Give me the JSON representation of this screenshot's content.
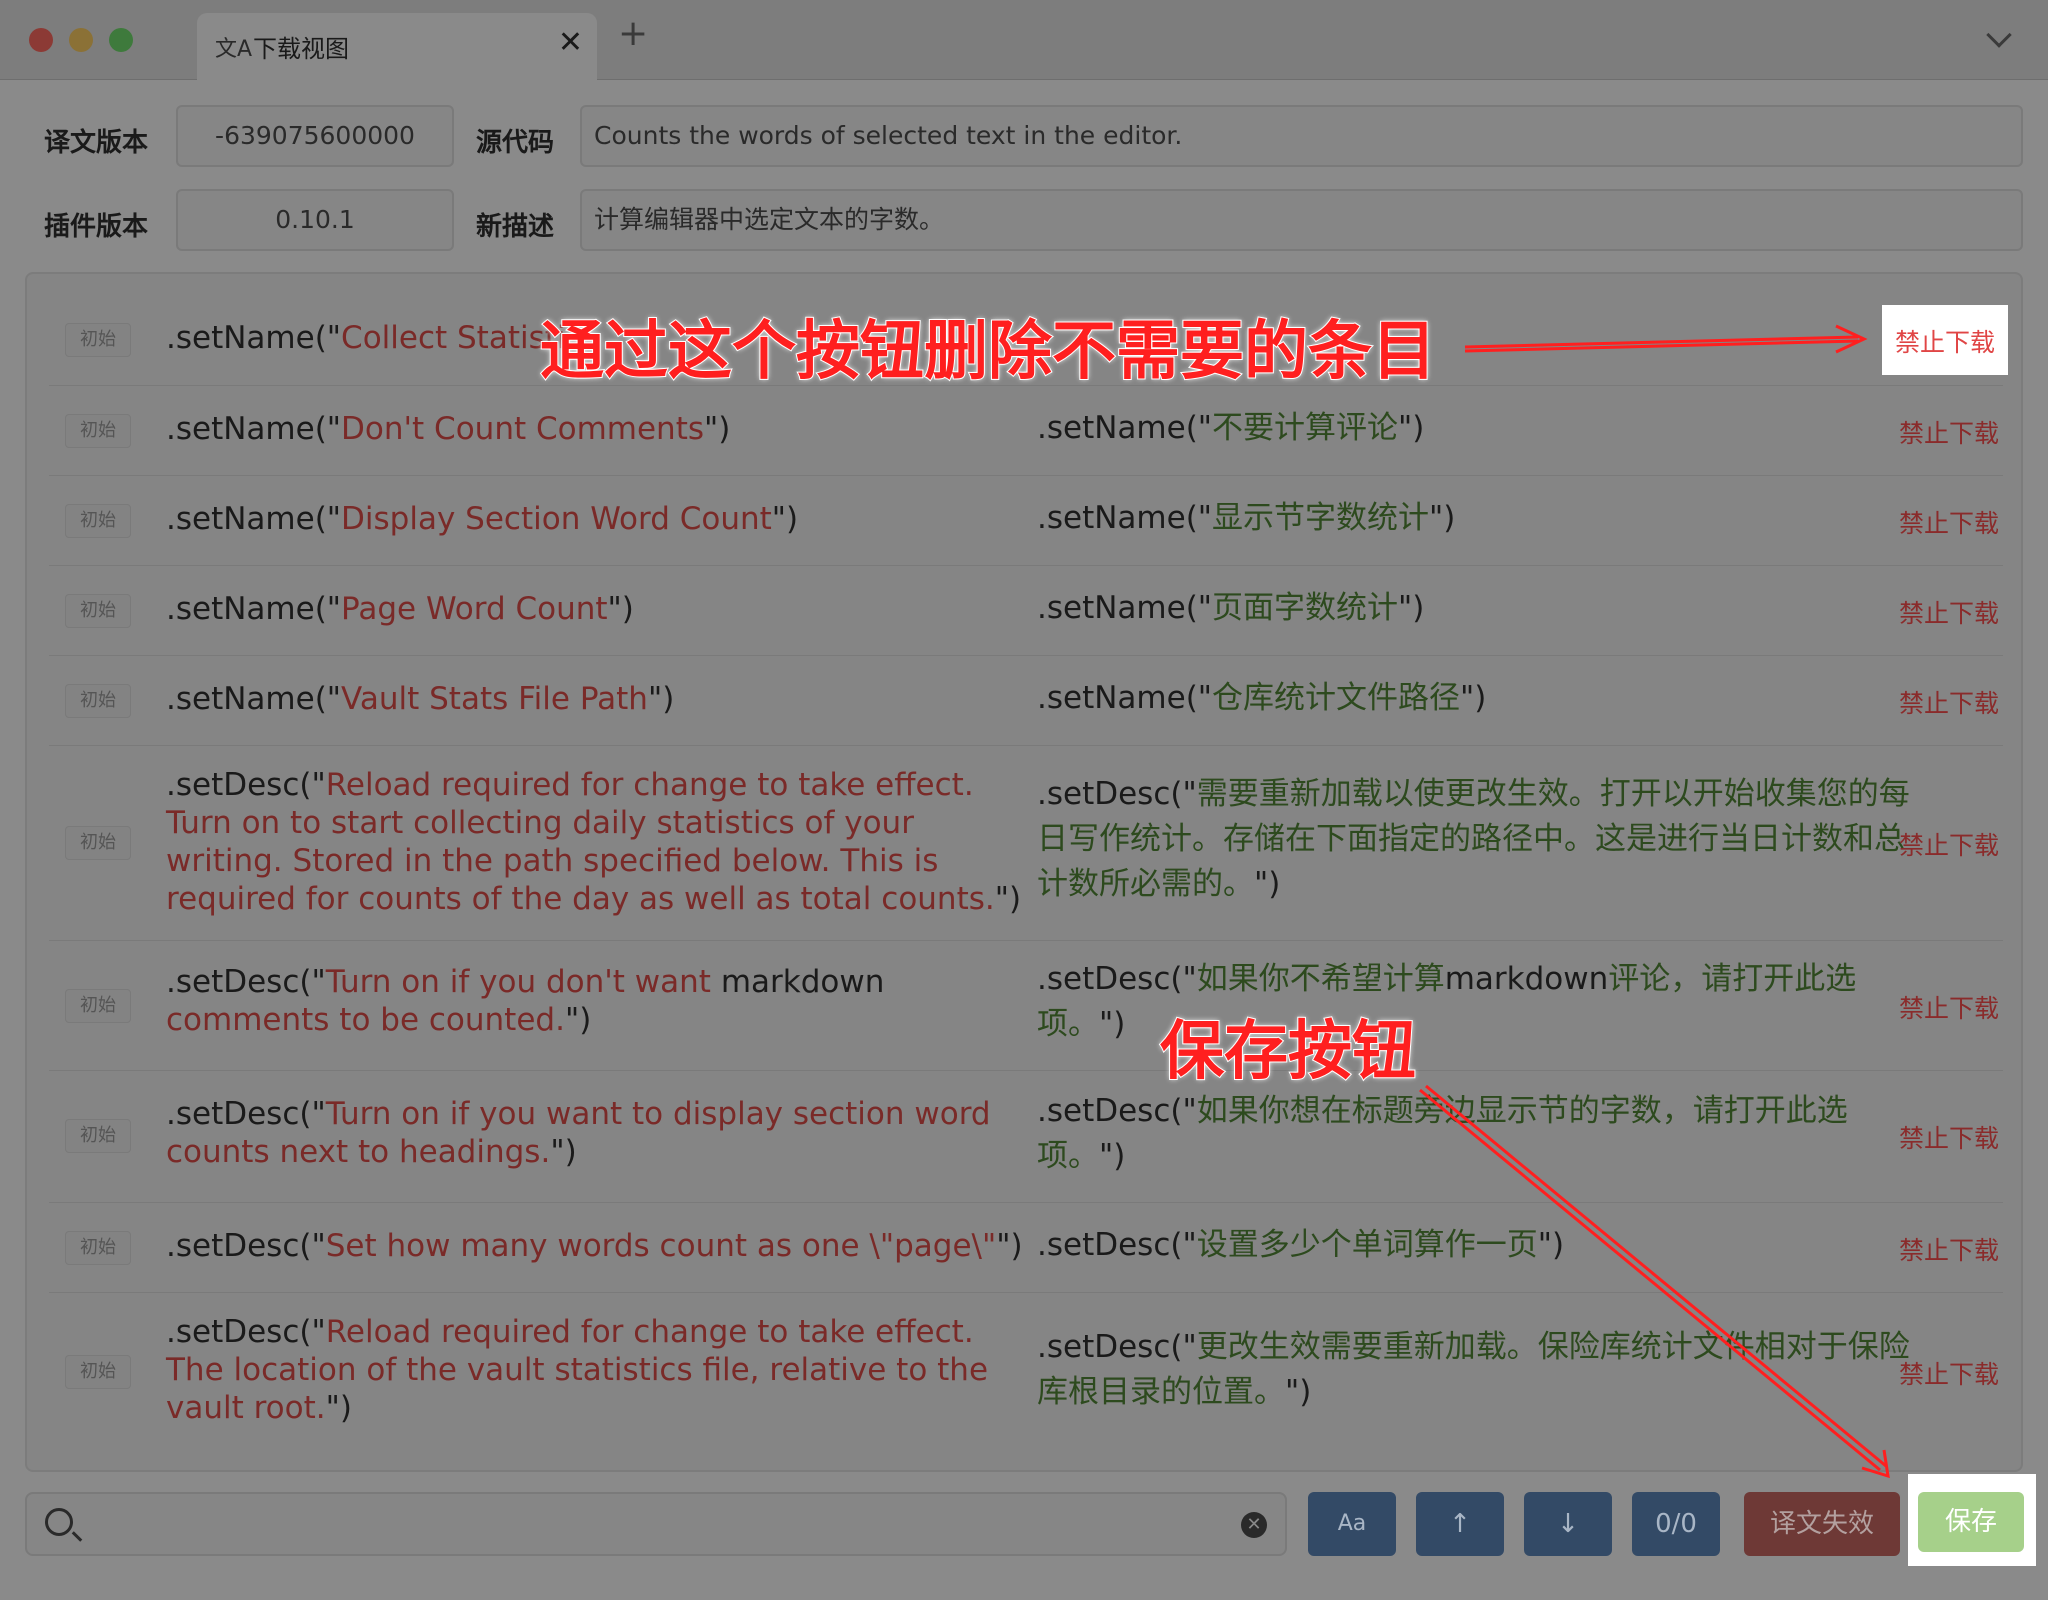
{
  "tab": {
    "icon": "translate-icon",
    "icon_glyph": "文A",
    "title": "下载视图",
    "close": "✕",
    "add": "+"
  },
  "info": {
    "translation_version_label": "译文版本",
    "translation_version": "-639075600000",
    "plugin_version_label": "插件版本",
    "plugin_version": "0.10.1",
    "source_label": "源代码",
    "source_desc": "Counts the words of selected text in the editor.",
    "new_desc_label": "新描述",
    "new_desc": "计算编辑器中选定文本的字数。"
  },
  "rows": [
    {
      "badge": "初始",
      "src_pre": ".setName(\"",
      "src_txt": "Collect Statisti",
      "src_post": "",
      "dst_pre": "",
      "dst_txt": "",
      "dst_post": "",
      "ban": "禁止下载"
    },
    {
      "badge": "初始",
      "src_pre": ".setName(\"",
      "src_txt": "Don't Count Comments",
      "src_post": "\")",
      "dst_pre": ".setName(\"",
      "dst_txt": "不要计算评论",
      "dst_post": "\")",
      "ban": "禁止下载"
    },
    {
      "badge": "初始",
      "src_pre": ".setName(\"",
      "src_txt": "Display Section Word Count",
      "src_post": "\")",
      "dst_pre": ".setName(\"",
      "dst_txt": "显示节字数统计",
      "dst_post": "\")",
      "ban": "禁止下载"
    },
    {
      "badge": "初始",
      "src_pre": ".setName(\"",
      "src_txt": "Page Word Count",
      "src_post": "\")",
      "dst_pre": ".setName(\"",
      "dst_txt": "页面字数统计",
      "dst_post": "\")",
      "ban": "禁止下载"
    },
    {
      "badge": "初始",
      "src_pre": ".setName(\"",
      "src_txt": "Vault Stats File Path",
      "src_post": "\")",
      "dst_pre": ".setName(\"",
      "dst_txt": "仓库统计文件路径",
      "dst_post": "\")",
      "ban": "禁止下载"
    },
    {
      "badge": "初始",
      "src_pre": ".setDesc(\"",
      "src_txt": "Reload required for change to take effect. Turn on to start collecting daily statistics of your writing. Stored in the path specified below. This is required for counts of the day as well as total counts.",
      "src_post": "\")",
      "dst_pre": ".setDesc(\"",
      "dst_txt": "需要重新加载以使更改生效。打开以开始收集您的每日写作统计。存储在下面指定的路径中。这是进行当日计数和总计数所必需的。",
      "dst_post": "\")",
      "ban": "禁止下载"
    },
    {
      "badge": "初始",
      "src_pre": ".setDesc(\"",
      "src_txt": "Turn on if you don't want ",
      "src_mid": "markdown",
      "src_txt2": " comments to be counted.",
      "src_post": "\")",
      "dst_pre": ".setDesc(\"",
      "dst_txt": "如果你不希望计算",
      "dst_mid": "markdown",
      "dst_txt2": "评论，请打开此选项。",
      "dst_post": "\")",
      "ban": "禁止下载"
    },
    {
      "badge": "初始",
      "src_pre": ".setDesc(\"",
      "src_txt": "Turn on if you want to display section word counts next to headings.",
      "src_post": "\")",
      "dst_pre": ".setDesc(\"",
      "dst_txt": "如果你想在标题旁边显示节的字数，请打开此选项。",
      "dst_post": "\")",
      "ban": "禁止下载"
    },
    {
      "badge": "初始",
      "src_pre": ".setDesc(\"",
      "src_txt": "Set how many words count as one \\\"page\\\"",
      "src_post": "\")",
      "dst_pre": ".setDesc(\"",
      "dst_txt": "设置多少个单词算作一页",
      "dst_post": "\")",
      "ban": "禁止下载"
    },
    {
      "badge": "初始",
      "src_pre": ".setDesc(\"",
      "src_txt": "Reload required for change to take effect. The location of the vault statistics file, relative to the vault root.",
      "src_post": "\")",
      "dst_pre": ".setDesc(\"",
      "dst_txt": "更改生效需要重新加载。保险库统计文件相对于保险库根目录的位置。",
      "dst_post": "\")",
      "ban": "禁止下载"
    }
  ],
  "toolbar": {
    "search_placeholder": "",
    "case_label": "Aa",
    "up_label": "↑",
    "down_label": "↓",
    "match_count": "0/0",
    "invalidate_label": "译文失效",
    "save_label": "保存"
  },
  "annotations": {
    "delete_hint": "通过这个按钮删除不需要的条目",
    "save_hint": "保存按钮",
    "color": "#ff1f1f"
  }
}
